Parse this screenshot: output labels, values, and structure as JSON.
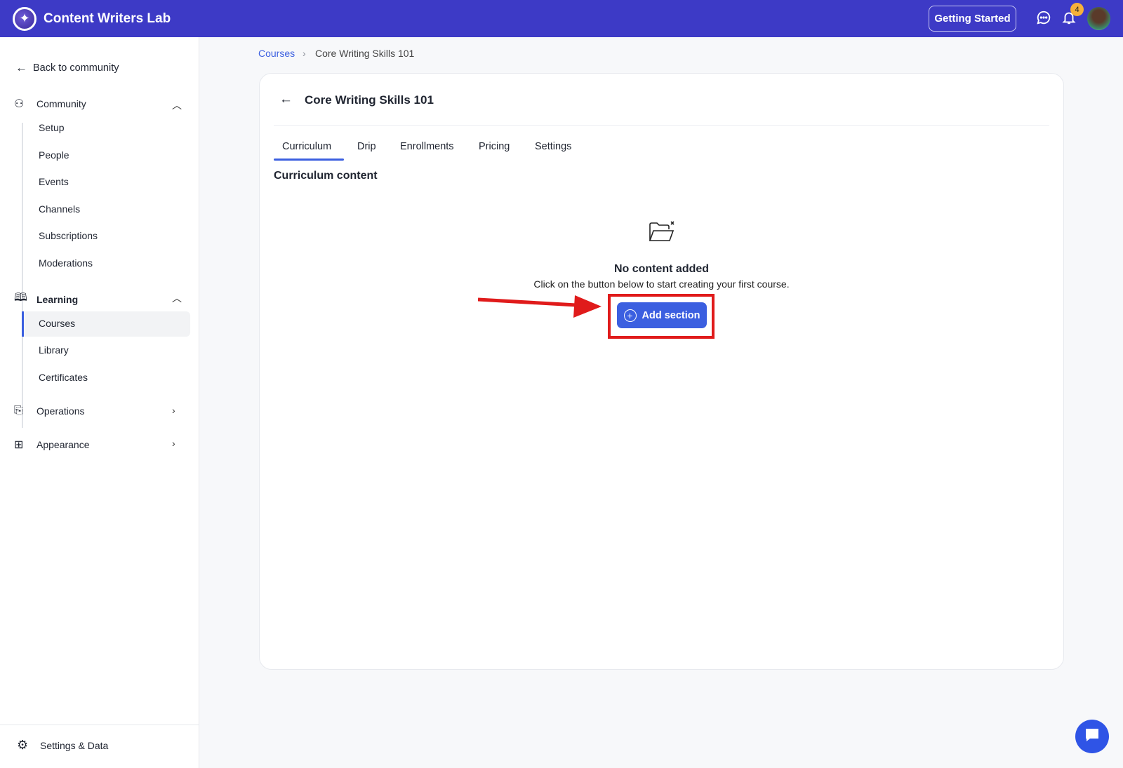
{
  "header": {
    "brand": "Content Writers Lab",
    "getting_started": "Getting Started",
    "notification_count": "4"
  },
  "sidebar": {
    "back": "Back to community",
    "community": {
      "label": "Community",
      "items": [
        "Setup",
        "People",
        "Events",
        "Channels",
        "Subscriptions",
        "Moderations"
      ]
    },
    "learning": {
      "label": "Learning",
      "items": [
        "Courses",
        "Library",
        "Certificates"
      ]
    },
    "operations": "Operations",
    "appearance": "Appearance",
    "settings": "Settings & Data"
  },
  "breadcrumb": {
    "root": "Courses",
    "current": "Core Writing Skills 101"
  },
  "course": {
    "title": "Core Writing Skills 101",
    "tabs": [
      "Curriculum",
      "Drip",
      "Enrollments",
      "Pricing",
      "Settings"
    ],
    "active_tab": "Curriculum",
    "section_title": "Curriculum content",
    "empty_title": "No content added",
    "empty_desc": "Click on the button below to start creating your first course.",
    "add_section": "Add section"
  },
  "colors": {
    "brand": "#3d3ac6",
    "accent": "#3b5fe0",
    "annotation": "#e01b1b"
  }
}
